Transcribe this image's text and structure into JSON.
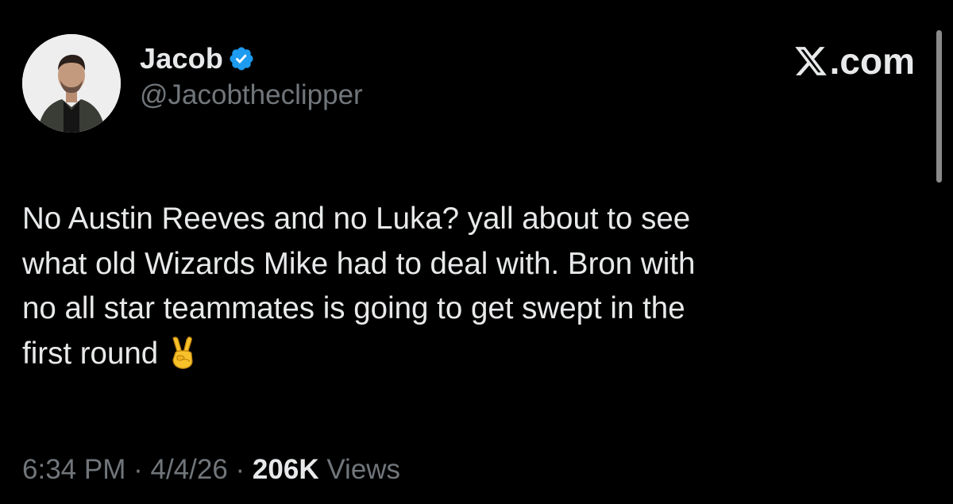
{
  "author": {
    "display_name": "Jacob",
    "handle": "@Jacobtheclipper",
    "verified": true,
    "avatar_icon": "profile-photo"
  },
  "brand": {
    "logo_icon": "x-logo-icon",
    "domain_suffix": ".com"
  },
  "tweet": {
    "line_1": "No Austin Reeves and no Luka? yall about to see",
    "line_2": "what old Wizards Mike had to deal with. Bron with",
    "line_3": "no all star teammates is going to get swept in the",
    "line_4": "first round",
    "emoji": "victory-hand-emoji"
  },
  "meta": {
    "time": "6:34 PM",
    "separator": "·",
    "date": "4/4/26",
    "views_count": "206K",
    "views_label": "Views"
  },
  "colors": {
    "background": "#000000",
    "primary_text": "#e7e9ea",
    "secondary_text": "#71767b",
    "verified_blue": "#1d9bf0"
  }
}
